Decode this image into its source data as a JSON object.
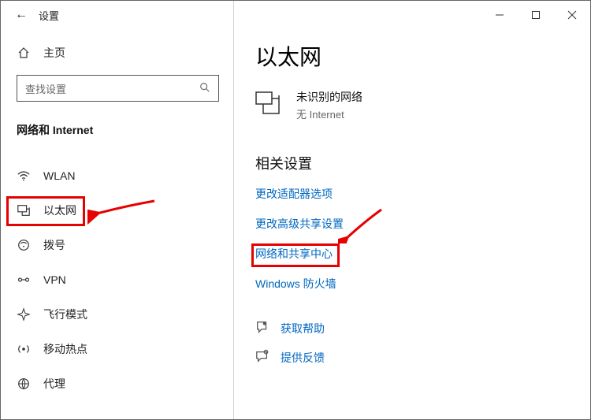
{
  "titlebar": {
    "title": "设置"
  },
  "sidebar": {
    "home_label": "主页",
    "search_placeholder": "查找设置",
    "section_title": "网络和 Internet",
    "items": [
      {
        "label": "WLAN"
      },
      {
        "label": "以太网"
      },
      {
        "label": "拨号"
      },
      {
        "label": "VPN"
      },
      {
        "label": "飞行模式"
      },
      {
        "label": "移动热点"
      },
      {
        "label": "代理"
      }
    ]
  },
  "content": {
    "title": "以太网",
    "status_line1": "未识别的网络",
    "status_line2": "无 Internet",
    "related_header": "相关设置",
    "links": [
      "更改适配器选项",
      "更改高级共享设置",
      "网络和共享中心",
      "Windows 防火墙"
    ],
    "help_link": "获取帮助",
    "feedback_link": "提供反馈"
  }
}
